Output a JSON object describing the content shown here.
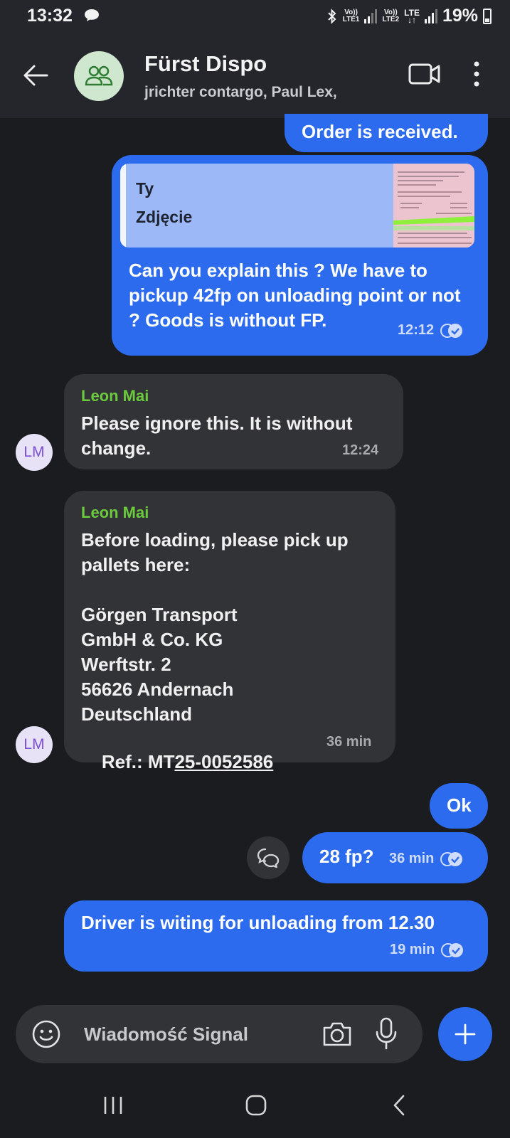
{
  "status_bar": {
    "time": "13:32",
    "sim1": {
      "volte": "Vo))",
      "network": "LTE1"
    },
    "sim2": {
      "volte": "Vo))",
      "network": "LTE2",
      "type": "LTE"
    },
    "battery": "19%",
    "icons": [
      "chat-bubble-icon",
      "bluetooth-icon",
      "signal-icon",
      "battery-icon"
    ]
  },
  "header": {
    "title": "Fürst Dispo",
    "subtitle": "jrichter contargo, Paul Lex,",
    "icons": [
      "back-arrow-icon",
      "group-icon",
      "video-call-icon",
      "more-vertical-icon"
    ]
  },
  "messages": {
    "m1": {
      "text": "Order is received."
    },
    "m2": {
      "quote_author": "Ty",
      "quote_type": "Zdjęcie",
      "text": "Can you explain this ? We have to pickup 42fp on unloading point or not ? Goods is without FP.",
      "time": "12:12"
    },
    "m3": {
      "sender": "Leon Mai",
      "avatar": "LM",
      "text": "Please ignore this. It is without change.",
      "time": "12:24"
    },
    "m4": {
      "sender": "Leon Mai",
      "avatar": "LM",
      "text": "Before loading, please pick up pallets here:\n\nGörgen Transport\nGmbH & Co. KG\nWerftstr. 2\n56626 Andernach\nDeutschland",
      "ref_prefix": "Ref.: MT",
      "ref_link": "25-0052586",
      "time": "36 min"
    },
    "m5": {
      "text": "Ok"
    },
    "m6": {
      "text": "28 fp?",
      "time": "36 min"
    },
    "m7": {
      "text": "Driver is witing for unloading from 12.30",
      "time": "19 min"
    }
  },
  "composer": {
    "placeholder": "Wiadomość Signal",
    "icons": [
      "emoji-icon",
      "camera-icon",
      "microphone-icon",
      "plus-icon"
    ]
  },
  "colors": {
    "outgoing_bubble": "#2c6bed",
    "incoming_bubble": "#323337",
    "sender_name": "#6ccb3d",
    "background": "#1b1c1f",
    "header": "#24262b"
  }
}
